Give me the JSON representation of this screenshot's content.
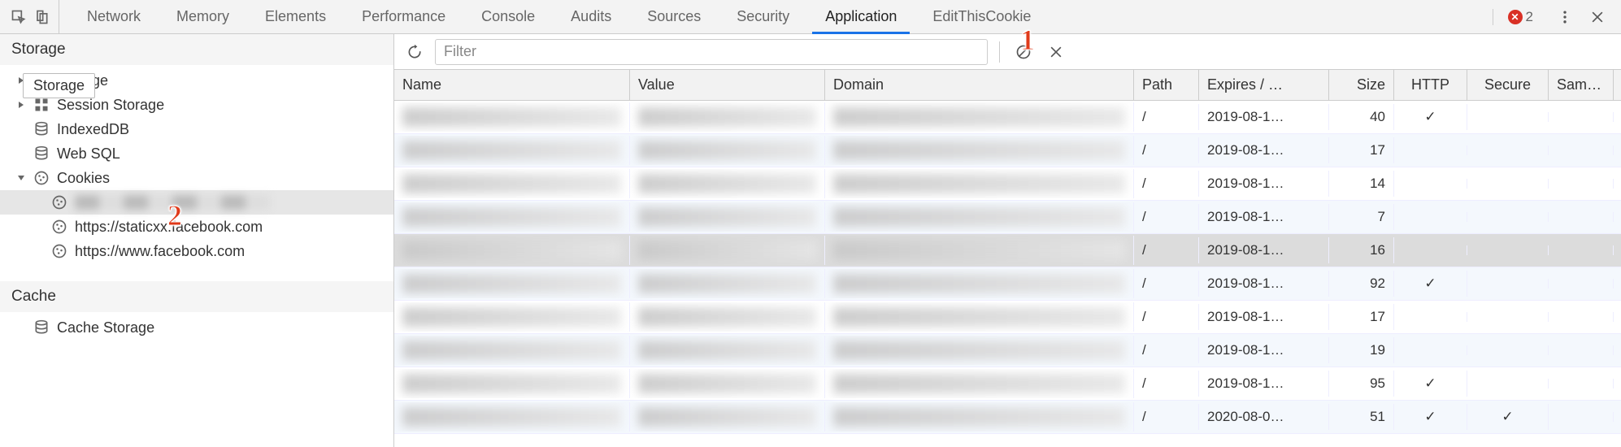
{
  "tabs": [
    "Network",
    "Memory",
    "Elements",
    "Performance",
    "Console",
    "Audits",
    "Sources",
    "Security",
    "Application",
    "EditThisCookie"
  ],
  "active_tab_index": 8,
  "error_count": "2",
  "sidebar": {
    "section_storage": "Storage",
    "tooltip": "Storage",
    "items": {
      "local_storage": "Storage",
      "session_storage": "Session Storage",
      "indexeddb": "IndexedDB",
      "websql": "Web SQL",
      "cookies": "Cookies",
      "cookie_origins": [
        "",
        "https://staticxx.facebook.com",
        "https://www.facebook.com"
      ]
    },
    "section_cache": "Cache",
    "cache_storage": "Cache Storage"
  },
  "toolbar": {
    "filter_placeholder": "Filter"
  },
  "columns": {
    "name": "Name",
    "value": "Value",
    "domain": "Domain",
    "path": "Path",
    "expires": "Expires / …",
    "size": "Size",
    "http": "HTTP",
    "secure": "Secure",
    "same": "Sam…"
  },
  "rows": [
    {
      "path": "/",
      "expires": "2019-08-1…",
      "size": "40",
      "http": "✓",
      "secure": "",
      "same": ""
    },
    {
      "path": "/",
      "expires": "2019-08-1…",
      "size": "17",
      "http": "",
      "secure": "",
      "same": ""
    },
    {
      "path": "/",
      "expires": "2019-08-1…",
      "size": "14",
      "http": "",
      "secure": "",
      "same": ""
    },
    {
      "path": "/",
      "expires": "2019-08-1…",
      "size": "7",
      "http": "",
      "secure": "",
      "same": ""
    },
    {
      "path": "/",
      "expires": "2019-08-1…",
      "size": "16",
      "http": "",
      "secure": "",
      "same": "",
      "selected": true
    },
    {
      "path": "/",
      "expires": "2019-08-1…",
      "size": "92",
      "http": "✓",
      "secure": "",
      "same": ""
    },
    {
      "path": "/",
      "expires": "2019-08-1…",
      "size": "17",
      "http": "",
      "secure": "",
      "same": ""
    },
    {
      "path": "/",
      "expires": "2019-08-1…",
      "size": "19",
      "http": "",
      "secure": "",
      "same": ""
    },
    {
      "path": "/",
      "expires": "2019-08-1…",
      "size": "95",
      "http": "✓",
      "secure": "",
      "same": ""
    },
    {
      "path": "/",
      "expires": "2020-08-0…",
      "size": "51",
      "http": "✓",
      "secure": "✓",
      "same": ""
    }
  ],
  "annotations": {
    "one": "1",
    "two": "2"
  }
}
